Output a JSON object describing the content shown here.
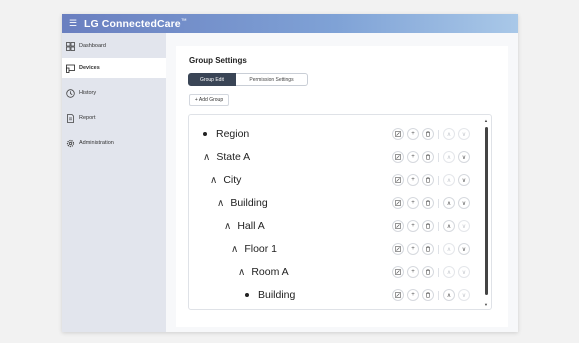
{
  "app": {
    "brand": "LG ConnectedCare",
    "trademark": "™"
  },
  "sidebar": {
    "items": [
      {
        "label": "Dashboard",
        "icon": "dashboard-icon",
        "active": false
      },
      {
        "label": "Devices",
        "icon": "devices-icon",
        "active": true
      },
      {
        "label": "History",
        "icon": "history-icon",
        "active": false
      },
      {
        "label": "Report",
        "icon": "report-icon",
        "active": false
      },
      {
        "label": "Administration",
        "icon": "gear-icon",
        "active": false
      }
    ]
  },
  "main": {
    "title": "Group Settings",
    "tabs": [
      {
        "label": "Group Edit",
        "active": true
      },
      {
        "label": "Permission Settings",
        "active": false
      }
    ],
    "add_button": "+ Add Group",
    "tree": [
      {
        "label": "Region",
        "marker": "bullet",
        "depth": 0,
        "up_enabled": false,
        "down_enabled": false
      },
      {
        "label": "State A",
        "marker": "caret",
        "depth": 0,
        "up_enabled": false,
        "down_enabled": true
      },
      {
        "label": "City",
        "marker": "caret",
        "depth": 1,
        "up_enabled": false,
        "down_enabled": true
      },
      {
        "label": "Building",
        "marker": "caret",
        "depth": 2,
        "up_enabled": true,
        "down_enabled": true
      },
      {
        "label": "Hall A",
        "marker": "caret",
        "depth": 3,
        "up_enabled": true,
        "down_enabled": false
      },
      {
        "label": "Floor 1",
        "marker": "caret",
        "depth": 4,
        "up_enabled": false,
        "down_enabled": true
      },
      {
        "label": "Room A",
        "marker": "caret",
        "depth": 5,
        "up_enabled": false,
        "down_enabled": false
      },
      {
        "label": "Building",
        "marker": "bullet",
        "depth": 6,
        "up_enabled": true,
        "down_enabled": false
      }
    ]
  },
  "colors": {
    "topbar_start": "#6a7fc0",
    "topbar_end": "#a9c8e8",
    "tab_active": "#3a4556"
  }
}
